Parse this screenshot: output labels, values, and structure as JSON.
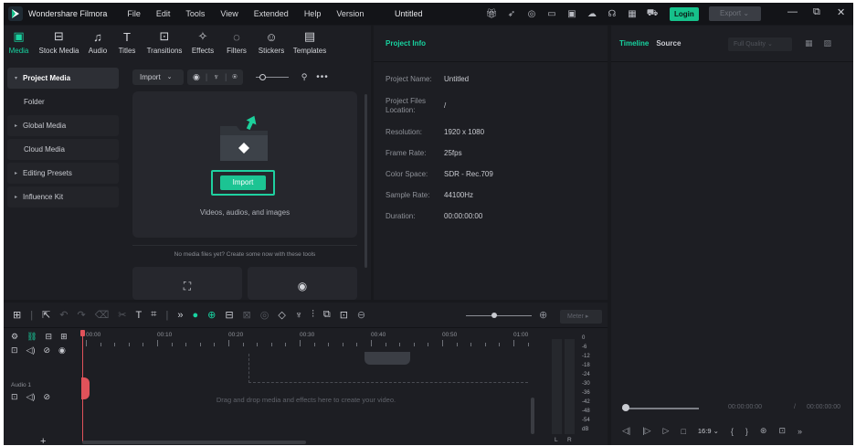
{
  "titlebar": {
    "app_name": "Wondershare Filmora",
    "menu": [
      "File",
      "Edit",
      "Tools",
      "View",
      "Extended",
      "Help",
      "Version"
    ],
    "document_title": "Untitled",
    "login_label": "Login",
    "export_label": "Export",
    "export_chevron": "⌄",
    "icons": [
      "gift-icon",
      "send-icon",
      "lightbulb-icon",
      "monitor-icon",
      "save-icon",
      "cloud-icon",
      "headset-icon",
      "grid-icon",
      "cart-icon"
    ],
    "window_controls": [
      "—",
      "⧉",
      "✕"
    ]
  },
  "tool_tabs": [
    {
      "label": "Media",
      "icon": "media-icon",
      "glyph": "▣"
    },
    {
      "label": "Stock Media",
      "icon": "stock-media-icon",
      "glyph": "⊟"
    },
    {
      "label": "Audio",
      "icon": "audio-icon",
      "glyph": "♫"
    },
    {
      "label": "Titles",
      "icon": "titles-icon",
      "glyph": "T"
    },
    {
      "label": "Transitions",
      "icon": "transitions-icon",
      "glyph": "⊡"
    },
    {
      "label": "Effects",
      "icon": "effects-icon",
      "glyph": "✧"
    },
    {
      "label": "Filters",
      "icon": "filters-icon",
      "glyph": "◌"
    },
    {
      "label": "Stickers",
      "icon": "stickers-icon",
      "glyph": "☺"
    },
    {
      "label": "Templates",
      "icon": "templates-icon",
      "glyph": "▤"
    }
  ],
  "sidebar": {
    "items": [
      {
        "label": "Project Media",
        "caret": "▾"
      },
      {
        "label": "Folder",
        "caret": ""
      },
      {
        "label": "Global Media",
        "caret": "▸"
      },
      {
        "label": "Cloud Media",
        "caret": ""
      },
      {
        "label": "Editing Presets",
        "caret": "▸"
      },
      {
        "label": "Influence Kit",
        "caret": "▸"
      }
    ]
  },
  "media": {
    "import_dropdown": "Import",
    "import_chevron": "⌄",
    "import_button": "Import",
    "import_hint": "Videos, audios, and images",
    "tools_hint": "No media files yet? Create some now with these tools"
  },
  "project_info": {
    "title": "Project Info",
    "rows": [
      {
        "key": "Project Name:",
        "value": "Untitled"
      },
      {
        "key": "Project Files Location:",
        "value": "/"
      },
      {
        "key": "Resolution:",
        "value": "1920 x 1080"
      },
      {
        "key": "Frame Rate:",
        "value": "25fps"
      },
      {
        "key": "Color Space:",
        "value": "SDR - Rec.709"
      },
      {
        "key": "Sample Rate:",
        "value": "44100Hz"
      },
      {
        "key": "Duration:",
        "value": "00:00:00:00"
      }
    ]
  },
  "preview": {
    "tab_timeline": "Timeline",
    "tab_source": "Source",
    "quality": "Full Quality",
    "quality_chevron": "⌄",
    "time_current": "00:00:00:00",
    "time_sep": "/",
    "time_total": "00:00:00:00",
    "ratio": "16:9",
    "ratio_chevron": "⌄"
  },
  "timeline": {
    "meter_label": "Meter",
    "meter_chevron": "▸",
    "ruler": [
      "00:00",
      "00:10",
      "00:20",
      "00:30",
      "00:40",
      "00:50",
      "01:00"
    ],
    "audio_track": "Audio 1",
    "drop_text": "Drag and drop media and effects here to create your video.",
    "meter_db": [
      "0",
      "-6",
      "-12",
      "-18",
      "-24",
      "-30",
      "-36",
      "-42",
      "-48",
      "-54",
      "dB"
    ],
    "meter_channels": [
      "L",
      "R"
    ],
    "add_track": "+"
  },
  "colors": {
    "accent": "#18d3a0",
    "playhead": "#e0525a",
    "background": "#18191d"
  }
}
